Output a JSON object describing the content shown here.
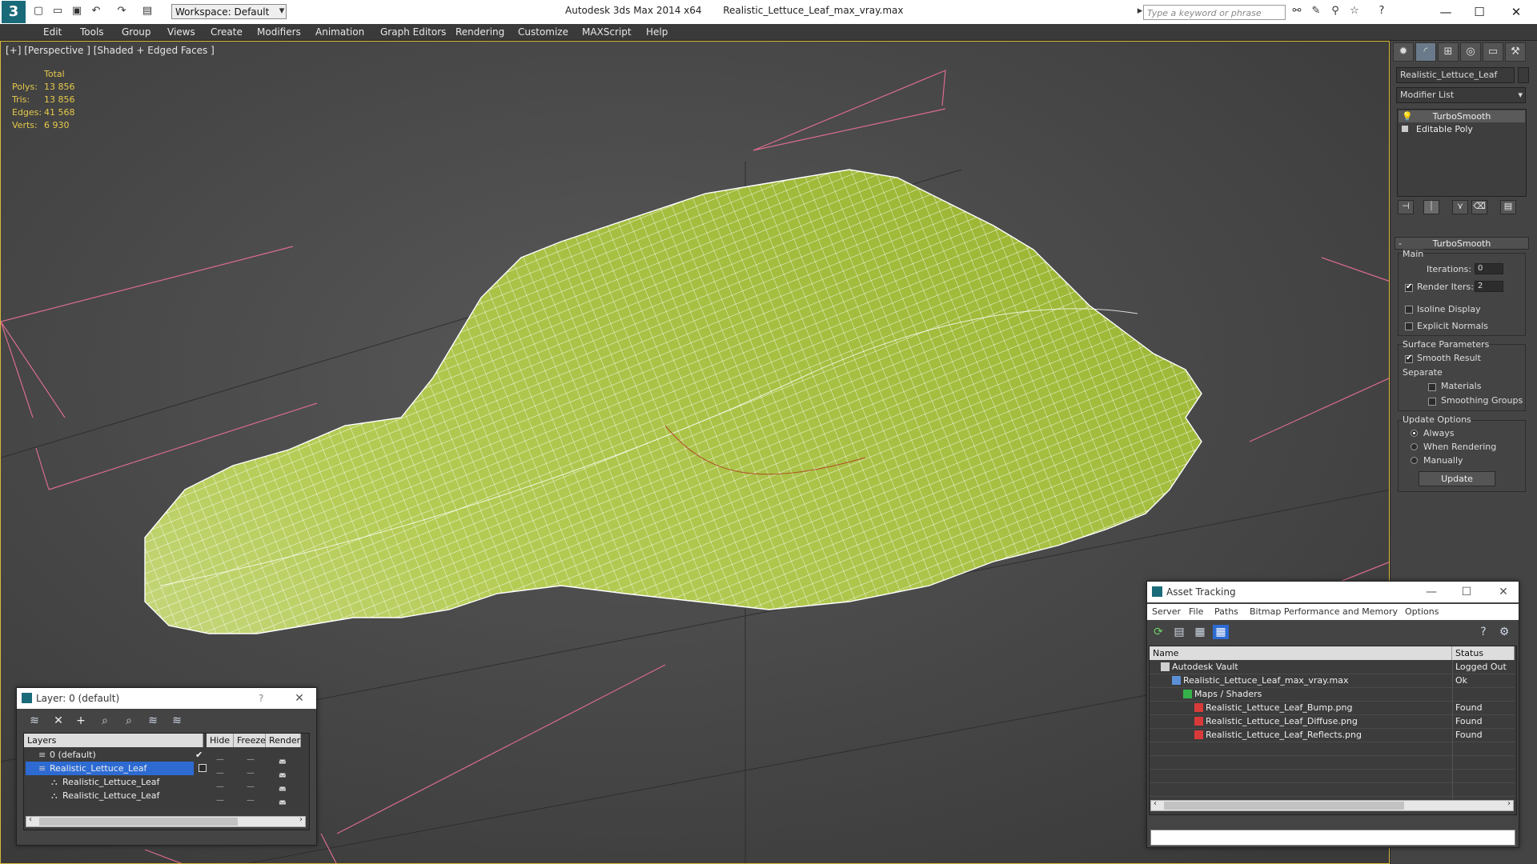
{
  "titlebar": {
    "app_title": "Autodesk 3ds Max  2014 x64",
    "file_name": "Realistic_Lettuce_Leaf_max_vray.max",
    "workspace": "Workspace: Default",
    "search_placeholder": "Type a keyword or phrase"
  },
  "menu": [
    "Edit",
    "Tools",
    "Group",
    "Views",
    "Create",
    "Modifiers",
    "Animation",
    "Graph Editors",
    "Rendering",
    "Customize",
    "MAXScript",
    "Help"
  ],
  "viewport": {
    "label": "[+] [Perspective ] [Shaded + Edged Faces ]",
    "stats": {
      "header": "Total",
      "rows": [
        {
          "label": "Polys:",
          "value": "13 856"
        },
        {
          "label": "Tris:",
          "value": "13 856"
        },
        {
          "label": "Edges:",
          "value": "41 568"
        },
        {
          "label": "Verts:",
          "value": "6 930"
        }
      ]
    }
  },
  "command_panel": {
    "object_name": "Realistic_Lettuce_Leaf",
    "modifier_list": "Modifier List",
    "stack": [
      "TurboSmooth",
      "Editable Poly"
    ],
    "turbosmooth": {
      "header": "TurboSmooth",
      "main": "Main",
      "iterations_label": "Iterations:",
      "iterations_value": "0",
      "render_iters_label": "Render Iters:",
      "render_iters_value": "2",
      "render_iters_checked": true,
      "isoline": "Isoline Display",
      "explicit_normals": "Explicit Normals",
      "surface_params": "Surface Parameters",
      "smooth_result": "Smooth Result",
      "separate": "Separate",
      "materials": "Materials",
      "smoothing_groups": "Smoothing Groups",
      "update_options": "Update Options",
      "always": "Always",
      "when_rendering": "When Rendering",
      "manually": "Manually",
      "update_btn": "Update"
    }
  },
  "layer_dialog": {
    "title": "Layer: 0 (default)",
    "help": "?",
    "columns": [
      "Layers",
      "Hide",
      "Freeze",
      "Render"
    ],
    "rows": [
      {
        "name": "0 (default)",
        "indent": 0
      },
      {
        "name": "Realistic_Lettuce_Leaf",
        "indent": 0
      },
      {
        "name": "Realistic_Lettuce_Leaf",
        "indent": 1
      },
      {
        "name": "Realistic_Lettuce_Leaf",
        "indent": 1
      }
    ]
  },
  "asset_tracking": {
    "title": "Asset Tracking",
    "menu": [
      "Server",
      "File",
      "Paths",
      "Bitmap Performance and Memory",
      "Options"
    ],
    "columns": [
      "Name",
      "Status"
    ],
    "rows": [
      {
        "name": "Autodesk Vault",
        "status": "Logged Out",
        "indent": 1
      },
      {
        "name": "Realistic_Lettuce_Leaf_max_vray.max",
        "status": "Ok",
        "indent": 2
      },
      {
        "name": "Maps / Shaders",
        "status": "",
        "indent": 3
      },
      {
        "name": "Realistic_Lettuce_Leaf_Bump.png",
        "status": "Found",
        "indent": 4
      },
      {
        "name": "Realistic_Lettuce_Leaf_Diffuse.png",
        "status": "Found",
        "indent": 4
      },
      {
        "name": "Realistic_Lettuce_Leaf_Reflects.png",
        "status": "Found",
        "indent": 4
      }
    ]
  },
  "colors": {
    "accent": "#e6c94a",
    "selection": "#2d6bd3",
    "leaf": "#a9c23a"
  }
}
